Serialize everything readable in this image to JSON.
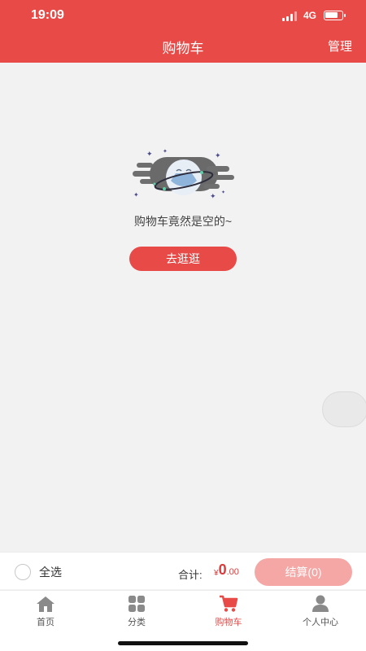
{
  "status_bar": {
    "time": "19:09",
    "network": "4G"
  },
  "header": {
    "title": "购物车",
    "manage_label": "管理"
  },
  "empty_state": {
    "message": "购物车竟然是空的~",
    "button_label": "去逛逛",
    "illustration_icon": "planet-illustration-icon"
  },
  "checkout": {
    "select_all_label": "全选",
    "total_label": "合计:",
    "currency": "¥",
    "amount_int": "0",
    "amount_dec": ".00",
    "checkout_label": "结算(0)"
  },
  "tabs": [
    {
      "label": "首页",
      "icon": "home-icon",
      "active": false
    },
    {
      "label": "分类",
      "icon": "category-grid-icon",
      "active": false
    },
    {
      "label": "购物车",
      "icon": "cart-icon",
      "active": true
    },
    {
      "label": "个人中心",
      "icon": "user-icon",
      "active": false
    }
  ],
  "colors": {
    "accent": "#e84a47",
    "checkout_disabled": "#f4a7a5",
    "background": "#f2f2f2"
  }
}
